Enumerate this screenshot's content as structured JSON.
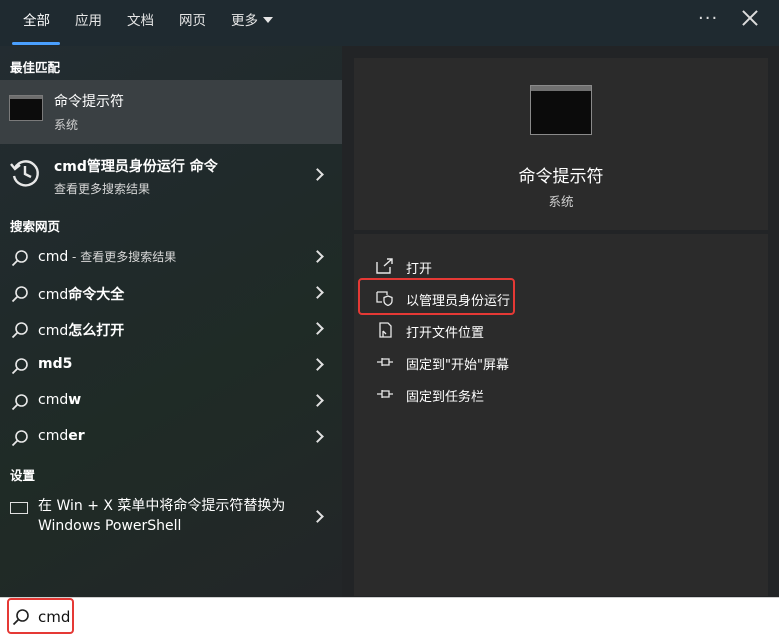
{
  "tabs": [
    {
      "label": "全部"
    },
    {
      "label": "应用"
    },
    {
      "label": "文档"
    },
    {
      "label": "网页"
    },
    {
      "label": "更多"
    }
  ],
  "top": {
    "more_icon": "more-horizontal-icon",
    "close_icon": "close-icon"
  },
  "left": {
    "best_match_heading": "最佳匹配",
    "best_match": {
      "title": "命令提示符",
      "subtitle": "系统",
      "icon": "command-prompt-icon"
    },
    "history": {
      "title": "cmd管理员身份运行 命令",
      "subtitle": "查看更多搜索结果",
      "icon": "history-icon"
    },
    "web_heading": "搜索网页",
    "web_results": [
      {
        "main": "cmd",
        "suffix": " - 查看更多搜索结果"
      },
      {
        "typed": "cmd",
        "rest": "命令大全"
      },
      {
        "typed": "cmd",
        "rest": "怎么打开"
      },
      {
        "typed": "",
        "rest": "md5"
      },
      {
        "typed": "cmd",
        "rest": "w"
      },
      {
        "typed": "cmd",
        "rest": "er"
      }
    ],
    "settings_heading": "设置",
    "settings_item": {
      "text": "在 Win + X 菜单中将命令提示符替换为 Windows PowerShell",
      "icon": "display-icon"
    }
  },
  "preview": {
    "title": "命令提示符",
    "subtitle": "系统",
    "icon": "command-prompt-icon"
  },
  "actions": [
    {
      "label": "打开",
      "icon": "open-icon"
    },
    {
      "label": "以管理员身份运行",
      "icon": "shield-admin-icon"
    },
    {
      "label": "打开文件位置",
      "icon": "file-location-icon"
    },
    {
      "label": "固定到\"开始\"屏幕",
      "icon": "pin-icon"
    },
    {
      "label": "固定到任务栏",
      "icon": "pin-icon"
    }
  ],
  "search": {
    "value": "cmd",
    "icon": "search-icon"
  },
  "colors": {
    "highlight_red": "#e53935",
    "accent_blue": "#4aa0ff"
  }
}
